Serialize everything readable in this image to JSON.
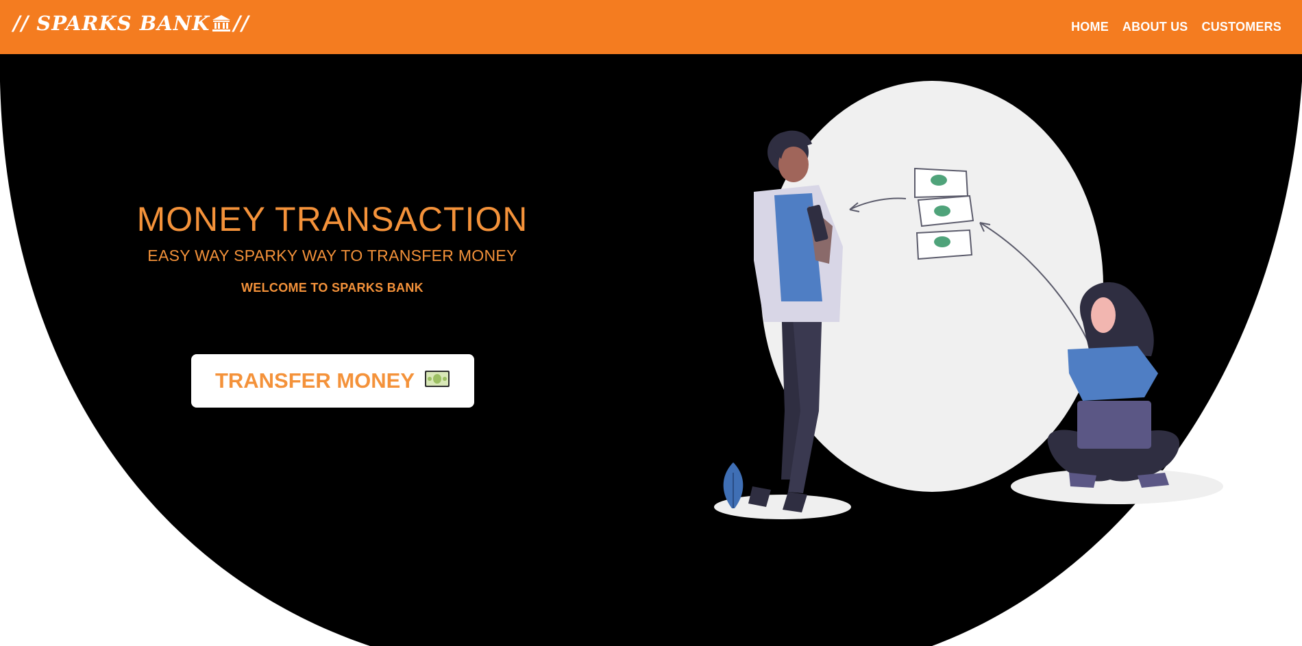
{
  "header": {
    "brand_prefix": "// SPARKS BANK",
    "brand_icon": "bank-icon",
    "brand_suffix": "//",
    "nav": [
      "HOME",
      "ABOUT US",
      "CUSTOMERS"
    ]
  },
  "hero": {
    "title": "MONEY TRANSACTION",
    "subtitle": "EASY WAY SPARKY WAY TO TRANSFER MONEY",
    "welcome": "WELCOME TO SPARKS BANK",
    "button_label": "TRANSFER MONEY",
    "button_icon": "dollar-bill-icon"
  },
  "colors": {
    "navbar": "#f47c20",
    "accent": "#f4923a",
    "hero_background": "#000000",
    "page_background": "#ffffff"
  }
}
